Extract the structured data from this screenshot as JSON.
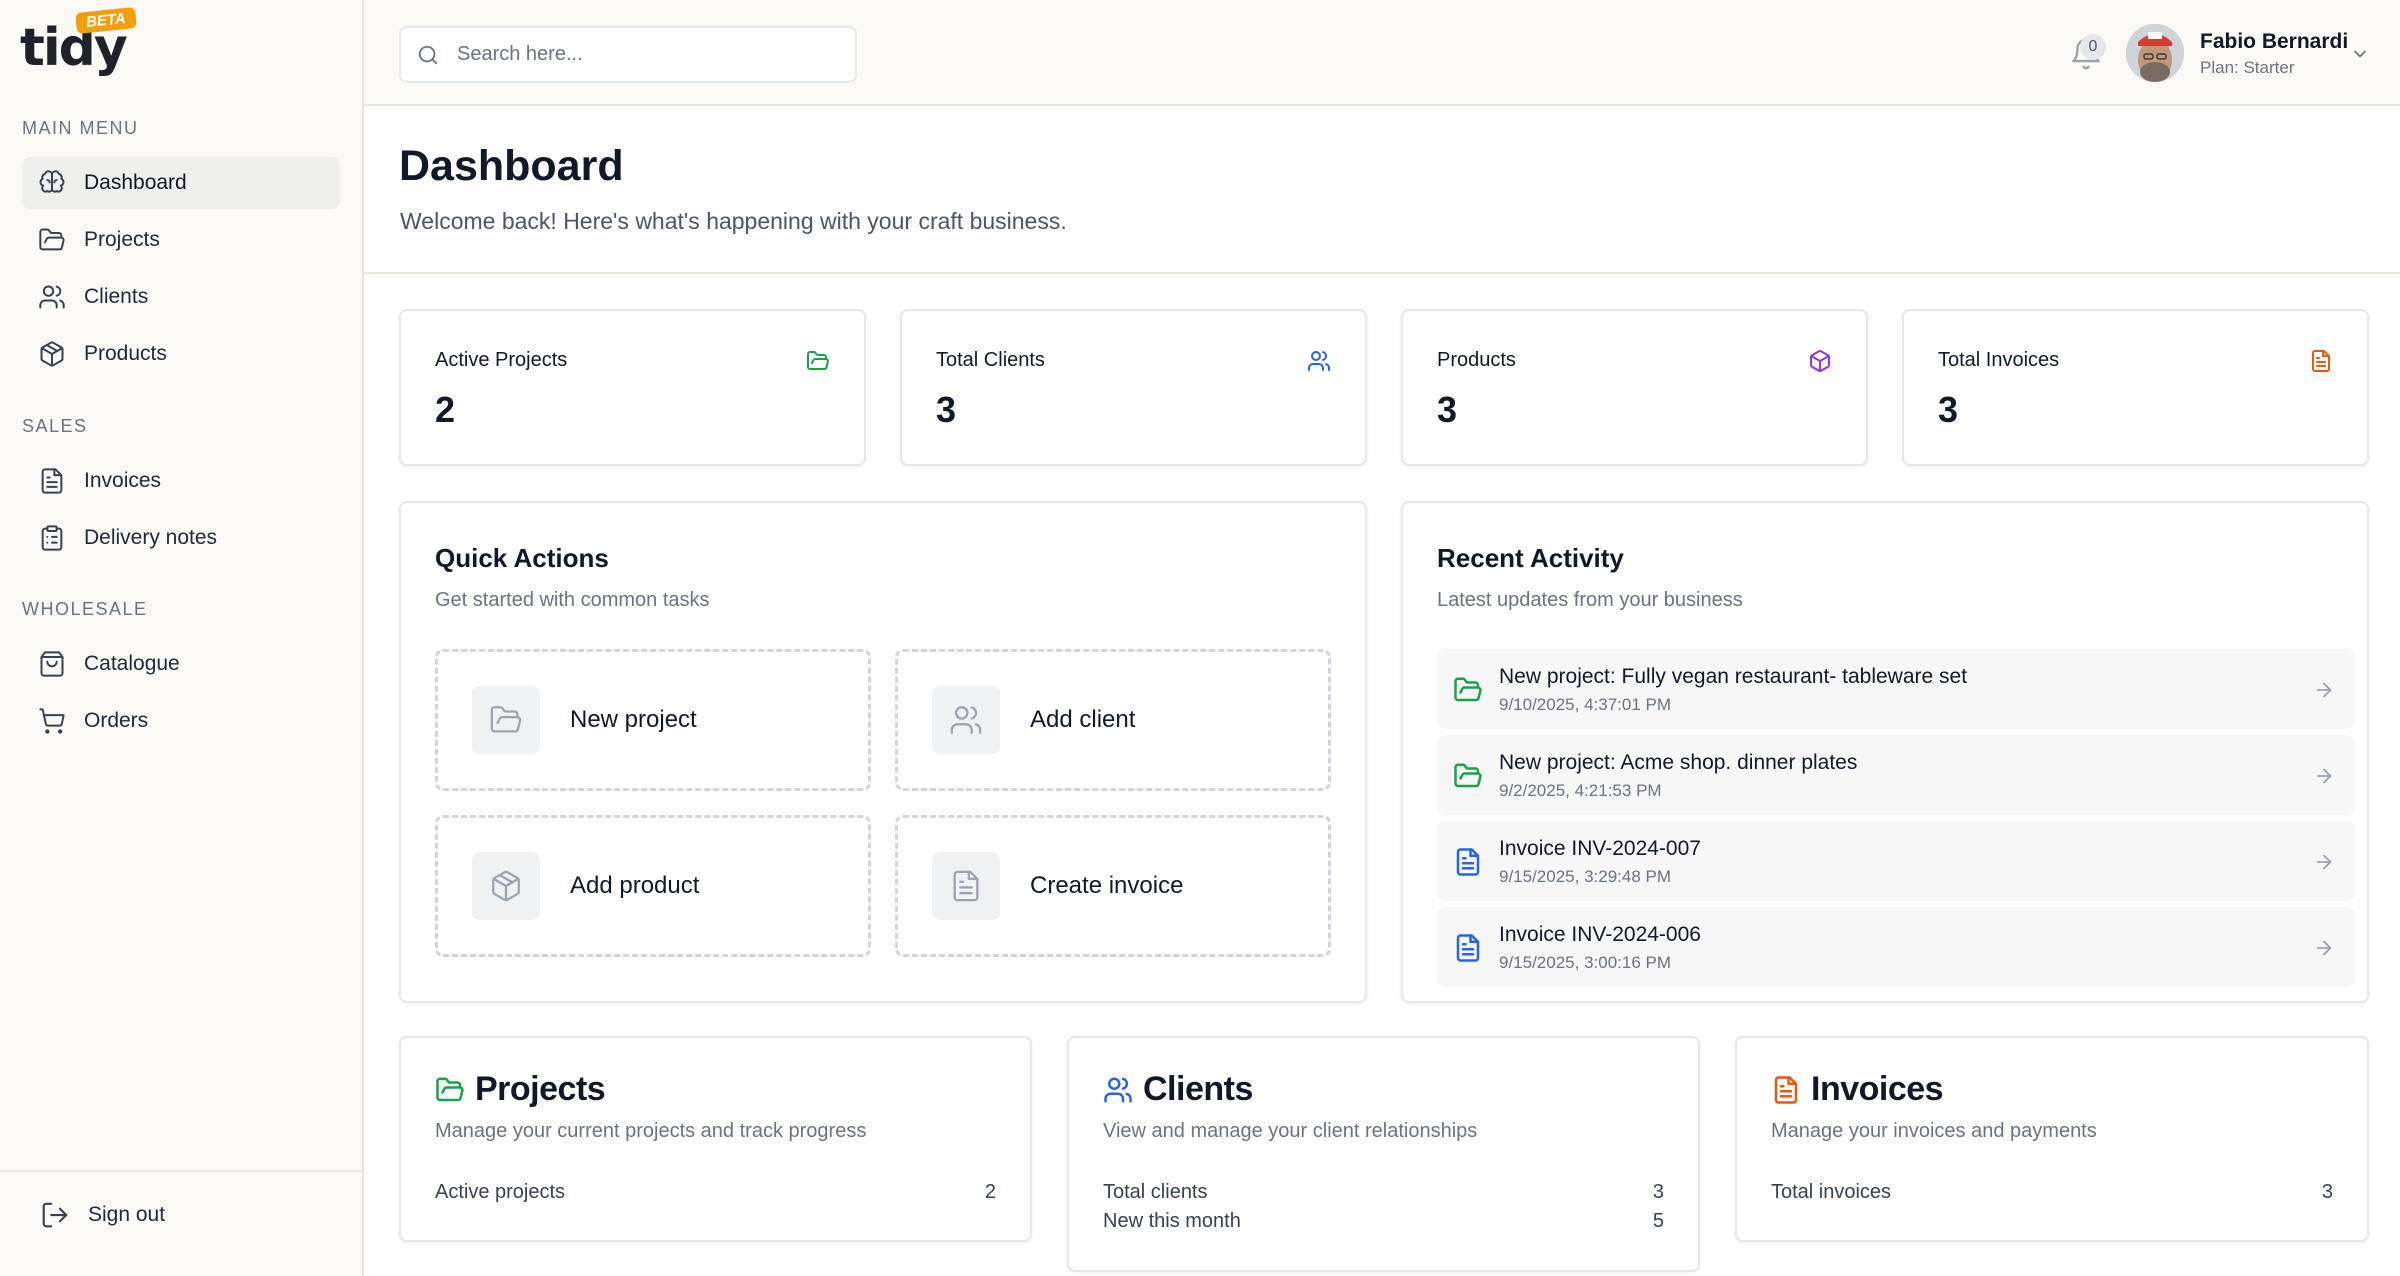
{
  "app": {
    "logo": "tidy",
    "badge": "BETA"
  },
  "sidebar": {
    "sections": [
      {
        "title": "MAIN MENU"
      },
      {
        "title": "SALES"
      },
      {
        "title": "WHOLESALE"
      }
    ],
    "items": [
      {
        "label": "Dashboard",
        "icon": "brain-icon",
        "active": true
      },
      {
        "label": "Projects",
        "icon": "folder-icon"
      },
      {
        "label": "Clients",
        "icon": "users-icon"
      },
      {
        "label": "Products",
        "icon": "box-icon"
      },
      {
        "label": "Invoices",
        "icon": "file-text-icon"
      },
      {
        "label": "Delivery notes",
        "icon": "clipboard-list-icon"
      },
      {
        "label": "Catalogue",
        "icon": "shopping-bag-icon"
      },
      {
        "label": "Orders",
        "icon": "shopping-cart-icon"
      }
    ],
    "signout": "Sign out"
  },
  "header": {
    "search_placeholder": "Search here...",
    "notifications": "0",
    "user_name": "Fabio Bernardi",
    "user_plan": "Plan: Starter"
  },
  "page": {
    "title": "Dashboard",
    "subtitle": "Welcome back! Here's what's happening with your craft business."
  },
  "stats": [
    {
      "label": "Active Projects",
      "value": "2",
      "icon": "folder-open-icon",
      "color": "#16a34a"
    },
    {
      "label": "Total Clients",
      "value": "3",
      "icon": "users-icon",
      "color": "#2563eb"
    },
    {
      "label": "Products",
      "value": "3",
      "icon": "box-icon",
      "color": "#9333ea"
    },
    {
      "label": "Total Invoices",
      "value": "3",
      "icon": "file-text-icon",
      "color": "#ea580c"
    }
  ],
  "quick_actions": {
    "title": "Quick Actions",
    "subtitle": "Get started with common tasks",
    "items": [
      {
        "label": "New project",
        "icon": "folder-open-icon"
      },
      {
        "label": "Add client",
        "icon": "users-icon"
      },
      {
        "label": "Add product",
        "icon": "box-icon"
      },
      {
        "label": "Create invoice",
        "icon": "file-text-icon"
      }
    ]
  },
  "recent_activity": {
    "title": "Recent Activity",
    "subtitle": "Latest updates from your business",
    "items": [
      {
        "title": "New project: Fully vegan restaurant- tableware set",
        "time": "9/10/2025, 4:37:01 PM",
        "icon": "folder-open-icon",
        "color": "#16a34a"
      },
      {
        "title": "New project: Acme shop. dinner plates",
        "time": "9/2/2025, 4:21:53 PM",
        "icon": "folder-open-icon",
        "color": "#16a34a"
      },
      {
        "title": "Invoice INV-2024-007",
        "time": "9/15/2025, 3:29:48 PM",
        "icon": "file-text-icon",
        "color": "#2563eb"
      },
      {
        "title": "Invoice INV-2024-006",
        "time": "9/15/2025, 3:00:16 PM",
        "icon": "file-text-icon",
        "color": "#2563eb"
      }
    ]
  },
  "summaries": [
    {
      "title": "Projects",
      "subtitle": "Manage your current projects and track progress",
      "icon": "folder-open-icon",
      "color": "#16a34a",
      "rows": [
        {
          "label": "Active projects",
          "value": "2"
        }
      ]
    },
    {
      "title": "Clients",
      "subtitle": "View and manage your client relationships",
      "icon": "users-icon",
      "color": "#2563eb",
      "rows": [
        {
          "label": "Total clients",
          "value": "3"
        },
        {
          "label": "New this month",
          "value": "5"
        }
      ]
    },
    {
      "title": "Invoices",
      "subtitle": "Manage your invoices and payments",
      "icon": "file-text-icon",
      "color": "#ea580c",
      "rows": [
        {
          "label": "Total invoices",
          "value": "3"
        }
      ]
    }
  ]
}
